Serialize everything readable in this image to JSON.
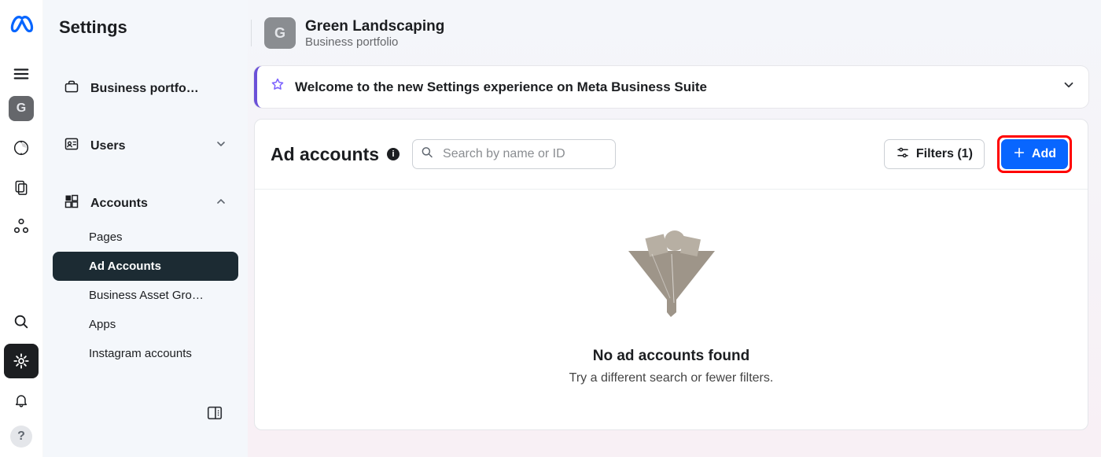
{
  "portfolio": {
    "avatar_initial": "G",
    "name": "Green Landscaping",
    "subtitle": "Business portfolio"
  },
  "rail": {
    "avatar_initial": "G"
  },
  "sidebar": {
    "title": "Settings",
    "items": [
      {
        "label": "Business portfo…"
      },
      {
        "label": "Users"
      },
      {
        "label": "Accounts"
      }
    ],
    "account_children": [
      {
        "label": "Pages"
      },
      {
        "label": "Ad Accounts",
        "active": true
      },
      {
        "label": "Business Asset Gro…"
      },
      {
        "label": "Apps"
      },
      {
        "label": "Instagram accounts"
      }
    ]
  },
  "welcome": {
    "text": "Welcome to the new Settings experience on Meta Business Suite"
  },
  "panel": {
    "title": "Ad accounts",
    "search_placeholder": "Search by name or ID",
    "filters_label": "Filters (1)",
    "add_label": "Add",
    "empty_title": "No ad accounts found",
    "empty_sub": "Try a different search or fewer filters."
  },
  "colors": {
    "primary": "#0866ff",
    "accent": "#6b51d8",
    "highlight": "#ff0000"
  }
}
